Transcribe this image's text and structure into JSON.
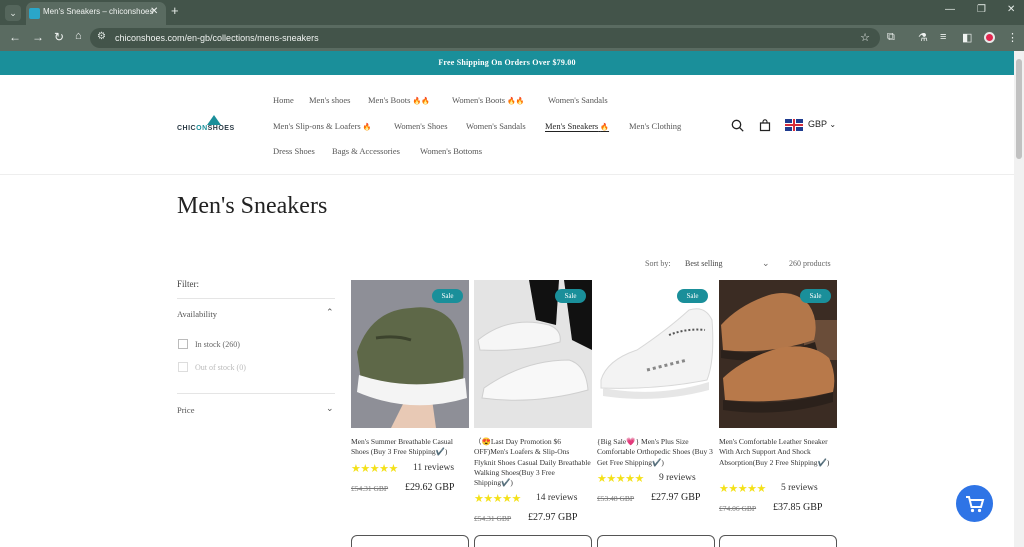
{
  "browser": {
    "tab_title": "Men's Sneakers – chiconshoes",
    "tab_close": "✕",
    "new_tab": "+",
    "url": "chiconshoes.com/en-gb/collections/mens-sneakers",
    "window_controls": [
      "—",
      "❐",
      "✕"
    ]
  },
  "announcement": "Free Shipping On Orders Over $79.00",
  "header": {
    "logo_text_pre": "CHIC",
    "logo_text_mid": "ON",
    "logo_text_post": "SHOES",
    "nav": [
      {
        "label": "Home"
      },
      {
        "label": "Men's shoes"
      },
      {
        "label": "Men's Boots",
        "badge": "🔥🔥"
      },
      {
        "label": "Women's Boots",
        "badge": "🔥🔥"
      },
      {
        "label": "Women's Sandals"
      },
      {
        "label": "Men's Slip-ons & Loafers",
        "badge": "🔥"
      },
      {
        "label": "Women's Shoes"
      },
      {
        "label": "Women's Sandals"
      },
      {
        "label": "Men's Sneakers",
        "badge": "🔥",
        "active": true
      },
      {
        "label": "Men's Clothing"
      },
      {
        "label": "Dress Shoes"
      },
      {
        "label": "Bags & Accessories"
      },
      {
        "label": "Women's Bottoms"
      }
    ],
    "currency": "GBP"
  },
  "page": {
    "title": "Men's Sneakers",
    "sort_label": "Sort by:",
    "sort_value": "Best selling",
    "product_count": "260 products"
  },
  "filters": {
    "heading": "Filter:",
    "availability": "Availability",
    "in_stock": "In stock (260)",
    "out_of_stock": "Out of stock (0)",
    "price": "Price"
  },
  "products": [
    {
      "badge": "Sale",
      "title": "Men's Summer Breathable Casual Shoes (Buy 3 Free Shipping✔️)",
      "stars": "★★★★★",
      "rating": 4.5,
      "reviews": "11 reviews",
      "old_price": "£54.31 GBP",
      "price": "£29.62 GBP"
    },
    {
      "badge": "Sale",
      "title": "（😍Last Day Promotion $6 OFF)Men's Loafers & Slip-Ons Flyknit Shoes Casual Daily Breathable Walking Shoes(Buy 3 Free Shipping✔️)",
      "stars": "★★★★★",
      "rating": 5,
      "reviews": "14 reviews",
      "old_price": "£54.31 GBP",
      "price": "£27.97 GBP"
    },
    {
      "badge": "Sale",
      "title": "{Big Sale💗} Men's Plus Size Comfortable Orthopedic Shoes (Buy 3 Get Free Shipping✔️)",
      "stars": "★★★★★",
      "rating": 4.5,
      "reviews": "9 reviews",
      "old_price": "£53.48 GBP",
      "price": "£27.97 GBP"
    },
    {
      "badge": "Sale",
      "title": "Men's Comfortable Leather Sneaker With Arch Support And Shock Absorption(Buy 2 Free Shipping✔️)",
      "stars": "★★★★★",
      "rating": 4.5,
      "reviews": "5 reviews",
      "old_price": "£74.06 GBP",
      "price": "£37.85 GBP"
    }
  ],
  "icons": {
    "search": "search-icon",
    "cart": "cart-icon",
    "flag": "uk-flag-icon",
    "cart_fab": "floating-cart-icon"
  },
  "colors": {
    "accent": "#1a8f9a",
    "star": "#f4e119",
    "cart_fab": "#2e74e6"
  }
}
